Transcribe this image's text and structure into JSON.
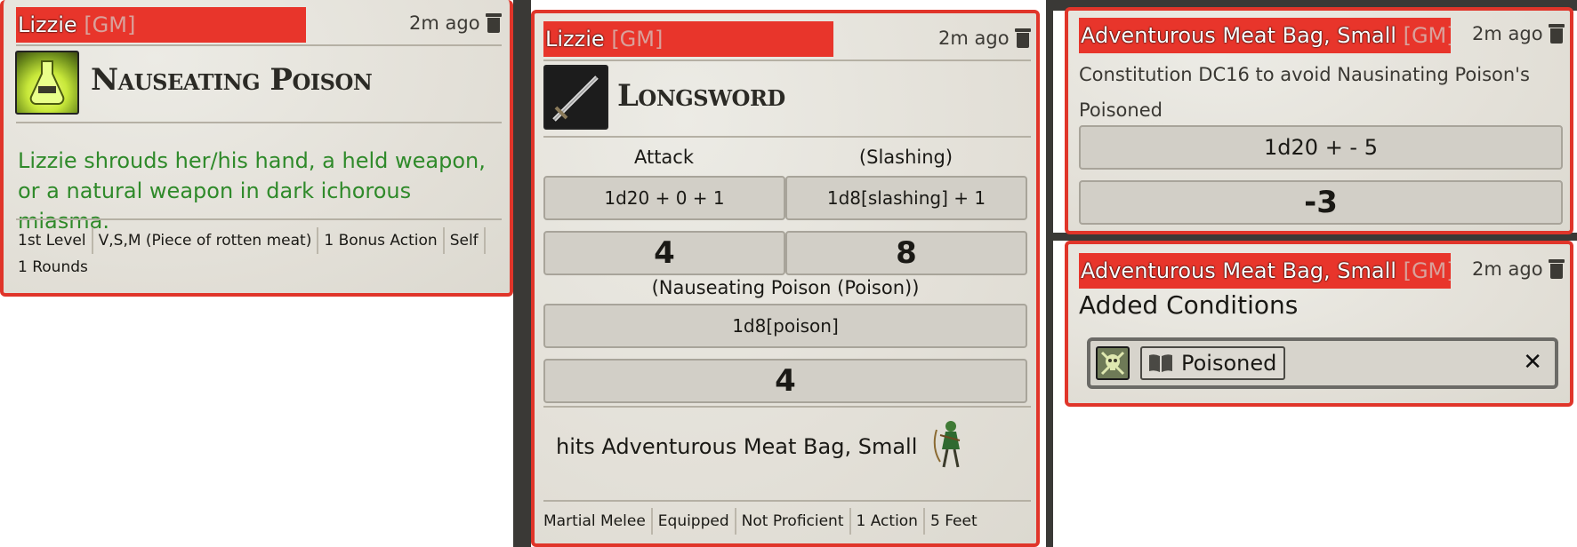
{
  "card1": {
    "speaker": "Lizzie",
    "gm": "[GM]",
    "time": "2m ago",
    "item_title": "Nauseating Poison",
    "description": "Lizzie shrouds her/his hand, a held weapon, or a natural weapon in dark ichorous miasma.",
    "tags": [
      "1st Level",
      "V,S,M (Piece of rotten meat)",
      "1 Bonus Action",
      "Self",
      "1 Rounds"
    ]
  },
  "card2": {
    "speaker": "Lizzie",
    "gm": "[GM]",
    "time": "2m ago",
    "item_title": "Longsword",
    "attack_label": "Attack",
    "damage_label": "(Slashing)",
    "attack_formula": "1d20 + 0 + 1",
    "damage_formula": "1d8[slashing] + 1",
    "attack_total": "4",
    "damage_total": "8",
    "poison_label": "(Nauseating Poison (Poison))",
    "poison_formula": "1d8[poison]",
    "poison_total": "4",
    "hit_text": "hits Adventurous Meat Bag, Small",
    "tags": [
      "Martial Melee",
      "Equipped",
      "Not Proficient",
      "1 Action",
      "5 Feet"
    ]
  },
  "card3": {
    "speaker": "Adventurous Meat Bag, Small",
    "gm": "[GM]",
    "time": "2m ago",
    "save_text": "Constitution DC16 to avoid Nausinating Poison's Poisoned",
    "formula": "1d20 + - 5",
    "total": "-3"
  },
  "card4": {
    "speaker": "Adventurous Meat Bag, Small",
    "gm": "[GM]",
    "time": "2m ago",
    "heading": "Added Conditions",
    "condition": "Poisoned",
    "close": "✕"
  },
  "colors": {
    "accent": "#e8352b",
    "green_text": "#2f8a2a",
    "dark_bg": "#3a3936"
  }
}
